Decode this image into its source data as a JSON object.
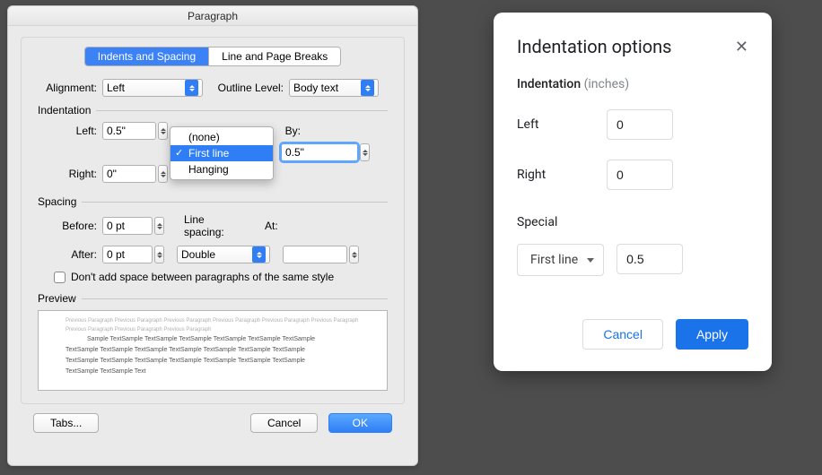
{
  "mac": {
    "title": "Paragraph",
    "tabs": {
      "active": "Indents and Spacing",
      "inactive": "Line and Page Breaks"
    },
    "alignment": {
      "label": "Alignment:",
      "value": "Left"
    },
    "outline": {
      "label": "Outline Level:",
      "value": "Body text"
    },
    "indent_section": "Indentation",
    "indent_left": {
      "label": "Left:",
      "value": "0.5\""
    },
    "indent_right": {
      "label": "Right:",
      "value": "0\""
    },
    "special": {
      "options": [
        "(none)",
        "First line",
        "Hanging"
      ],
      "selected": "First line"
    },
    "by": {
      "label": "By:",
      "value": "0.5\""
    },
    "spacing_section": "Spacing",
    "spacing_before": {
      "label": "Before:",
      "value": "0 pt"
    },
    "spacing_after": {
      "label": "After:",
      "value": "0 pt"
    },
    "line_spacing": {
      "label": "Line spacing:",
      "value": "Double"
    },
    "at": {
      "label": "At:",
      "value": ""
    },
    "checkbox_label": "Don't add space between paragraphs of the same style",
    "preview_label": "Preview",
    "preview_faint": "Previous Paragraph Previous Paragraph Previous Paragraph Previous Paragraph Previous Paragraph Previous Paragraph Previous Paragraph Previous Paragraph Previous Paragraph",
    "preview_lines": [
      "Sample TextSample TextSample TextSample TextSample TextSample TextSample",
      "TextSample TextSample TextSample TextSample TextSample TextSample TextSample",
      "TextSample TextSample TextSample TextSample TextSample TextSample TextSample",
      "TextSample TextSample Text"
    ],
    "footer": {
      "tabs": "Tabs...",
      "cancel": "Cancel",
      "ok": "OK"
    }
  },
  "google": {
    "title": "Indentation options",
    "sublabel": "Indentation",
    "unit": "(inches)",
    "left": {
      "label": "Left",
      "value": "0"
    },
    "right": {
      "label": "Right",
      "value": "0"
    },
    "special_label": "Special",
    "special_select": "First line",
    "special_value": "0.5",
    "cancel": "Cancel",
    "apply": "Apply"
  }
}
